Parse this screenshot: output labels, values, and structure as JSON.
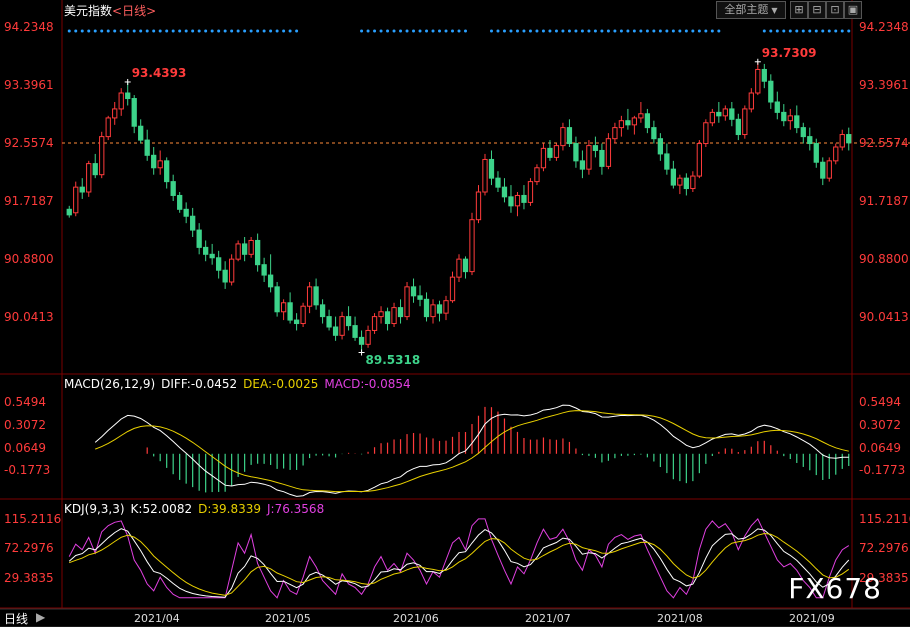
{
  "title_main": "美元指数",
  "title_period": "<日线>",
  "toolbar": {
    "theme_label": "全部主题",
    "theme_arrow": "▼",
    "btn_a": "⊞",
    "btn_b": "⊟",
    "btn_c": "⊡",
    "btn_d": "▣"
  },
  "colors": {
    "up": "#ff3b3b",
    "down": "#3dd38a",
    "axis": "#7a0000",
    "bg": "#000000",
    "price_dash": "#ff8c3a",
    "diff": "#ffffff",
    "dea": "#e8d000",
    "macd": "#e040e0",
    "dots": "#2aa0ff"
  },
  "chart_data": [
    {
      "type": "candlestick",
      "panel": "price",
      "ylim": [
        89.25,
        94.45
      ],
      "yticks": [
        "94.2348",
        "93.3961",
        "92.5574",
        "91.7187",
        "90.8800",
        "90.0413"
      ],
      "last_close": 92.5574,
      "annotations": [
        {
          "text": "93.4393",
          "value": 93.4393,
          "type": "high"
        },
        {
          "text": "93.7309",
          "value": 93.7309,
          "type": "high"
        },
        {
          "text": "89.5318",
          "value": 89.5318,
          "type": "low"
        }
      ],
      "x": [
        "2021-03-22",
        "2021-03-23",
        "2021-03-24",
        "2021-03-25",
        "2021-03-26",
        "2021-03-29",
        "2021-03-30",
        "2021-03-31",
        "2021-04-01",
        "2021-04-02",
        "2021-04-05",
        "2021-04-06",
        "2021-04-07",
        "2021-04-08",
        "2021-04-09",
        "2021-04-12",
        "2021-04-13",
        "2021-04-14",
        "2021-04-15",
        "2021-04-16",
        "2021-04-19",
        "2021-04-20",
        "2021-04-21",
        "2021-04-22",
        "2021-04-23",
        "2021-04-26",
        "2021-04-27",
        "2021-04-28",
        "2021-04-29",
        "2021-04-30",
        "2021-05-03",
        "2021-05-04",
        "2021-05-05",
        "2021-05-06",
        "2021-05-07",
        "2021-05-10",
        "2021-05-11",
        "2021-05-12",
        "2021-05-13",
        "2021-05-14",
        "2021-05-17",
        "2021-05-18",
        "2021-05-19",
        "2021-05-20",
        "2021-05-21",
        "2021-05-24",
        "2021-05-25",
        "2021-05-26",
        "2021-05-27",
        "2021-05-28",
        "2021-05-31",
        "2021-06-01",
        "2021-06-02",
        "2021-06-03",
        "2021-06-04",
        "2021-06-07",
        "2021-06-08",
        "2021-06-09",
        "2021-06-10",
        "2021-06-11",
        "2021-06-14",
        "2021-06-15",
        "2021-06-16",
        "2021-06-17",
        "2021-06-18",
        "2021-06-21",
        "2021-06-22",
        "2021-06-23",
        "2021-06-24",
        "2021-06-25",
        "2021-06-28",
        "2021-06-29",
        "2021-06-30",
        "2021-07-01",
        "2021-07-02",
        "2021-07-05",
        "2021-07-06",
        "2021-07-07",
        "2021-07-08",
        "2021-07-09",
        "2021-07-12",
        "2021-07-13",
        "2021-07-14",
        "2021-07-15",
        "2021-07-16",
        "2021-07-19",
        "2021-07-20",
        "2021-07-21",
        "2021-07-22",
        "2021-07-23",
        "2021-07-26",
        "2021-07-27",
        "2021-07-28",
        "2021-07-29",
        "2021-07-30",
        "2021-08-02",
        "2021-08-03",
        "2021-08-04",
        "2021-08-05",
        "2021-08-06",
        "2021-08-09",
        "2021-08-10",
        "2021-08-11",
        "2021-08-12",
        "2021-08-13",
        "2021-08-16",
        "2021-08-17",
        "2021-08-18",
        "2021-08-19",
        "2021-08-20",
        "2021-08-23",
        "2021-08-24",
        "2021-08-25",
        "2021-08-26",
        "2021-08-27",
        "2021-08-30",
        "2021-08-31",
        "2021-09-01",
        "2021-09-02",
        "2021-09-03",
        "2021-09-06"
      ],
      "ohlc": [
        [
          91.6,
          91.65,
          91.48,
          91.52
        ],
        [
          91.55,
          92.0,
          91.5,
          91.92
        ],
        [
          91.92,
          92.05,
          91.75,
          91.85
        ],
        [
          91.85,
          92.3,
          91.78,
          92.26
        ],
        [
          92.26,
          92.4,
          92.05,
          92.1
        ],
        [
          92.1,
          92.72,
          92.05,
          92.65
        ],
        [
          92.65,
          92.95,
          92.6,
          92.92
        ],
        [
          92.92,
          93.15,
          92.82,
          93.05
        ],
        [
          93.05,
          93.35,
          92.95,
          93.28
        ],
        [
          93.28,
          93.4393,
          93.1,
          93.2
        ],
        [
          93.2,
          93.25,
          92.7,
          92.8
        ],
        [
          92.8,
          92.9,
          92.55,
          92.6
        ],
        [
          92.6,
          92.75,
          92.3,
          92.38
        ],
        [
          92.38,
          92.5,
          92.1,
          92.2
        ],
        [
          92.2,
          92.45,
          92.1,
          92.3
        ],
        [
          92.3,
          92.35,
          91.9,
          92.0
        ],
        [
          92.0,
          92.1,
          91.72,
          91.8
        ],
        [
          91.8,
          91.85,
          91.55,
          91.6
        ],
        [
          91.6,
          91.7,
          91.4,
          91.5
        ],
        [
          91.5,
          91.62,
          91.2,
          91.3
        ],
        [
          91.3,
          91.4,
          90.95,
          91.05
        ],
        [
          91.05,
          91.15,
          90.85,
          90.95
        ],
        [
          90.95,
          91.1,
          90.8,
          90.9
        ],
        [
          90.9,
          91.0,
          90.6,
          90.72
        ],
        [
          90.72,
          90.85,
          90.45,
          90.55
        ],
        [
          90.55,
          90.95,
          90.5,
          90.88
        ],
        [
          90.88,
          91.15,
          90.85,
          91.1
        ],
        [
          91.1,
          91.2,
          90.85,
          90.95
        ],
        [
          90.95,
          91.2,
          90.9,
          91.15
        ],
        [
          91.15,
          91.25,
          90.7,
          90.8
        ],
        [
          90.8,
          90.9,
          90.55,
          90.65
        ],
        [
          90.65,
          90.95,
          90.4,
          90.48
        ],
        [
          90.48,
          90.55,
          90.05,
          90.12
        ],
        [
          90.12,
          90.3,
          90.0,
          90.25
        ],
        [
          90.25,
          90.4,
          89.95,
          90.0
        ],
        [
          90.0,
          90.1,
          89.85,
          89.95
        ],
        [
          89.95,
          90.25,
          89.9,
          90.2
        ],
        [
          90.2,
          90.55,
          90.1,
          90.48
        ],
        [
          90.48,
          90.6,
          90.15,
          90.22
        ],
        [
          90.22,
          90.3,
          89.95,
          90.05
        ],
        [
          90.05,
          90.15,
          89.85,
          89.9
        ],
        [
          89.9,
          90.05,
          89.7,
          89.78
        ],
        [
          89.78,
          90.12,
          89.72,
          90.05
        ],
        [
          90.05,
          90.2,
          89.85,
          89.92
        ],
        [
          89.92,
          90.05,
          89.7,
          89.75
        ],
        [
          89.75,
          89.85,
          89.5318,
          89.65
        ],
        [
          89.65,
          89.92,
          89.6,
          89.85
        ],
        [
          89.85,
          90.1,
          89.8,
          90.05
        ],
        [
          90.05,
          90.2,
          89.95,
          90.12
        ],
        [
          90.12,
          90.18,
          89.85,
          89.95
        ],
        [
          89.95,
          90.25,
          89.9,
          90.18
        ],
        [
          90.18,
          90.3,
          89.95,
          90.05
        ],
        [
          90.05,
          90.55,
          90.0,
          90.48
        ],
        [
          90.48,
          90.6,
          90.25,
          90.35
        ],
        [
          90.35,
          90.5,
          90.2,
          90.3
        ],
        [
          90.3,
          90.4,
          89.98,
          90.05
        ],
        [
          90.05,
          90.3,
          89.95,
          90.22
        ],
        [
          90.22,
          90.28,
          89.98,
          90.1
        ],
        [
          90.1,
          90.35,
          90.0,
          90.28
        ],
        [
          90.28,
          90.7,
          90.25,
          90.62
        ],
        [
          90.62,
          90.95,
          90.55,
          90.88
        ],
        [
          90.88,
          90.92,
          90.6,
          90.7
        ],
        [
          90.7,
          91.55,
          90.65,
          91.45
        ],
        [
          91.45,
          91.95,
          91.4,
          91.85
        ],
        [
          91.85,
          92.4,
          91.8,
          92.32
        ],
        [
          92.32,
          92.45,
          91.95,
          92.05
        ],
        [
          92.05,
          92.15,
          91.85,
          91.92
        ],
        [
          91.92,
          92.05,
          91.7,
          91.78
        ],
        [
          91.78,
          91.95,
          91.55,
          91.65
        ],
        [
          91.65,
          91.85,
          91.5,
          91.8
        ],
        [
          91.8,
          91.95,
          91.6,
          91.7
        ],
        [
          91.7,
          92.05,
          91.65,
          92.0
        ],
        [
          92.0,
          92.25,
          91.95,
          92.2
        ],
        [
          92.2,
          92.55,
          92.15,
          92.48
        ],
        [
          92.48,
          92.6,
          92.3,
          92.35
        ],
        [
          92.35,
          92.55,
          92.3,
          92.52
        ],
        [
          92.52,
          92.85,
          92.45,
          92.78
        ],
        [
          92.78,
          92.9,
          92.5,
          92.55
        ],
        [
          92.55,
          92.65,
          92.2,
          92.3
        ],
        [
          92.3,
          92.45,
          92.05,
          92.18
        ],
        [
          92.18,
          92.6,
          92.1,
          92.52
        ],
        [
          92.52,
          92.65,
          92.35,
          92.45
        ],
        [
          92.45,
          92.55,
          92.1,
          92.22
        ],
        [
          92.22,
          92.7,
          92.18,
          92.62
        ],
        [
          92.62,
          92.85,
          92.55,
          92.78
        ],
        [
          92.78,
          92.95,
          92.65,
          92.88
        ],
        [
          92.88,
          93.05,
          92.75,
          92.82
        ],
        [
          92.82,
          92.95,
          92.68,
          92.92
        ],
        [
          92.92,
          93.15,
          92.85,
          92.98
        ],
        [
          92.98,
          93.05,
          92.7,
          92.78
        ],
        [
          92.78,
          92.88,
          92.55,
          92.62
        ],
        [
          92.62,
          92.7,
          92.3,
          92.4
        ],
        [
          92.4,
          92.55,
          92.1,
          92.18
        ],
        [
          92.18,
          92.3,
          91.9,
          91.95
        ],
        [
          91.95,
          92.1,
          91.82,
          92.05
        ],
        [
          92.05,
          92.12,
          91.8,
          91.9
        ],
        [
          91.9,
          92.15,
          91.85,
          92.08
        ],
        [
          92.08,
          92.6,
          92.05,
          92.55
        ],
        [
          92.55,
          92.9,
          92.5,
          92.85
        ],
        [
          92.85,
          93.05,
          92.8,
          93.0
        ],
        [
          93.0,
          93.15,
          92.85,
          92.95
        ],
        [
          92.95,
          93.1,
          92.88,
          93.05
        ],
        [
          93.05,
          93.15,
          92.8,
          92.9
        ],
        [
          92.9,
          92.98,
          92.6,
          92.68
        ],
        [
          92.68,
          93.1,
          92.62,
          93.05
        ],
        [
          93.05,
          93.35,
          93.0,
          93.28
        ],
        [
          93.28,
          93.7309,
          93.25,
          93.62
        ],
        [
          93.62,
          93.7,
          93.35,
          93.45
        ],
        [
          93.45,
          93.55,
          93.05,
          93.15
        ],
        [
          93.15,
          93.3,
          92.9,
          93.0
        ],
        [
          93.0,
          93.12,
          92.8,
          92.88
        ],
        [
          92.88,
          93.05,
          92.75,
          92.95
        ],
        [
          92.95,
          93.1,
          92.7,
          92.78
        ],
        [
          92.78,
          92.85,
          92.55,
          92.65
        ],
        [
          92.65,
          92.78,
          92.45,
          92.55
        ],
        [
          92.55,
          92.62,
          92.2,
          92.28
        ],
        [
          92.28,
          92.35,
          91.95,
          92.05
        ],
        [
          92.05,
          92.35,
          92.0,
          92.3
        ],
        [
          92.3,
          92.55,
          92.25,
          92.5
        ],
        [
          92.5,
          92.75,
          92.45,
          92.68
        ],
        [
          92.68,
          92.78,
          92.45,
          92.56
        ]
      ]
    },
    {
      "type": "macd",
      "panel": "macd",
      "title": "MACD(26,12,9)",
      "readouts": {
        "diff": "DIFF:-0.0452",
        "dea": "DEA:-0.0025",
        "macd": "MACD:-0.0854"
      },
      "ylim": [
        -0.46,
        0.7
      ],
      "yticks": [
        "0.5494",
        "0.3072",
        "0.0649",
        "-0.1773"
      ],
      "dea_smoothing": 9
    },
    {
      "type": "kdj",
      "panel": "kdj",
      "title": "KDJ(9,3,3)",
      "readouts": {
        "k": "K:52.0082",
        "d": "D:39.8339",
        "j": "J:76.3568"
      },
      "ylim": [
        -12,
        125
      ],
      "yticks": [
        "115.2116",
        "72.2976",
        "29.3835"
      ],
      "j_values": [
        60,
        78,
        70,
        88,
        65,
        96,
        105,
        110,
        112,
        90,
        55,
        40,
        20,
        10,
        30,
        15,
        5,
        0,
        0,
        0,
        0,
        0,
        0,
        0,
        0,
        40,
        80,
        65,
        92,
        50,
        30,
        10,
        0,
        25,
        10,
        5,
        30,
        60,
        45,
        25,
        15,
        5,
        35,
        20,
        15,
        5,
        20,
        45,
        60,
        40,
        50,
        38,
        65,
        55,
        40,
        20,
        38,
        30,
        55,
        80,
        88,
        70,
        105,
        115,
        115,
        85,
        62,
        40,
        20,
        45,
        35,
        55,
        80,
        100,
        85,
        88,
        100,
        82,
        55,
        40,
        70,
        62,
        45,
        78,
        88,
        92,
        85,
        90,
        92,
        70,
        50,
        30,
        10,
        0,
        15,
        5,
        25,
        70,
        100,
        112,
        102,
        108,
        95,
        70,
        90,
        105,
        115,
        95,
        75,
        55,
        45,
        50,
        40,
        25,
        15,
        0,
        0,
        30,
        55,
        70,
        76
      ]
    }
  ],
  "x_tick_labels": [
    "2021/04",
    "2021/05",
    "2021/06",
    "2021/07",
    "2021/08",
    "2021/09"
  ],
  "bottom": {
    "tab_name": "日线",
    "tab_next": "▶"
  },
  "watermark": "FX678"
}
